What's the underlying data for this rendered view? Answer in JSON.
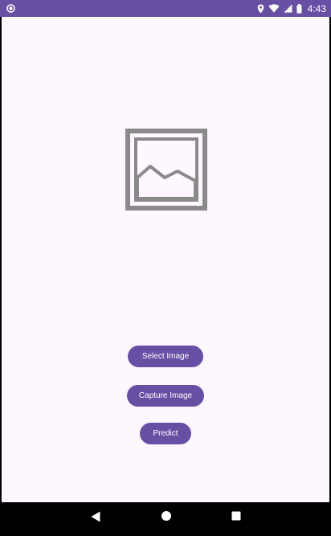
{
  "status_bar": {
    "time": "4:43",
    "left_icon": "notification-circle-icon",
    "icons": [
      "location-icon",
      "wifi-icon",
      "signal-icon",
      "battery-icon"
    ],
    "color": "#6750A4"
  },
  "main": {
    "image_placeholder_icon": "image-placeholder-icon",
    "background": "#FEF7FF",
    "buttons": {
      "select_image": "Select Image",
      "capture_image": "Capture Image",
      "predict": "Predict"
    },
    "accent": "#6750A4"
  },
  "nav_bar": {
    "icons": [
      "back-icon",
      "home-icon",
      "recents-icon"
    ]
  }
}
